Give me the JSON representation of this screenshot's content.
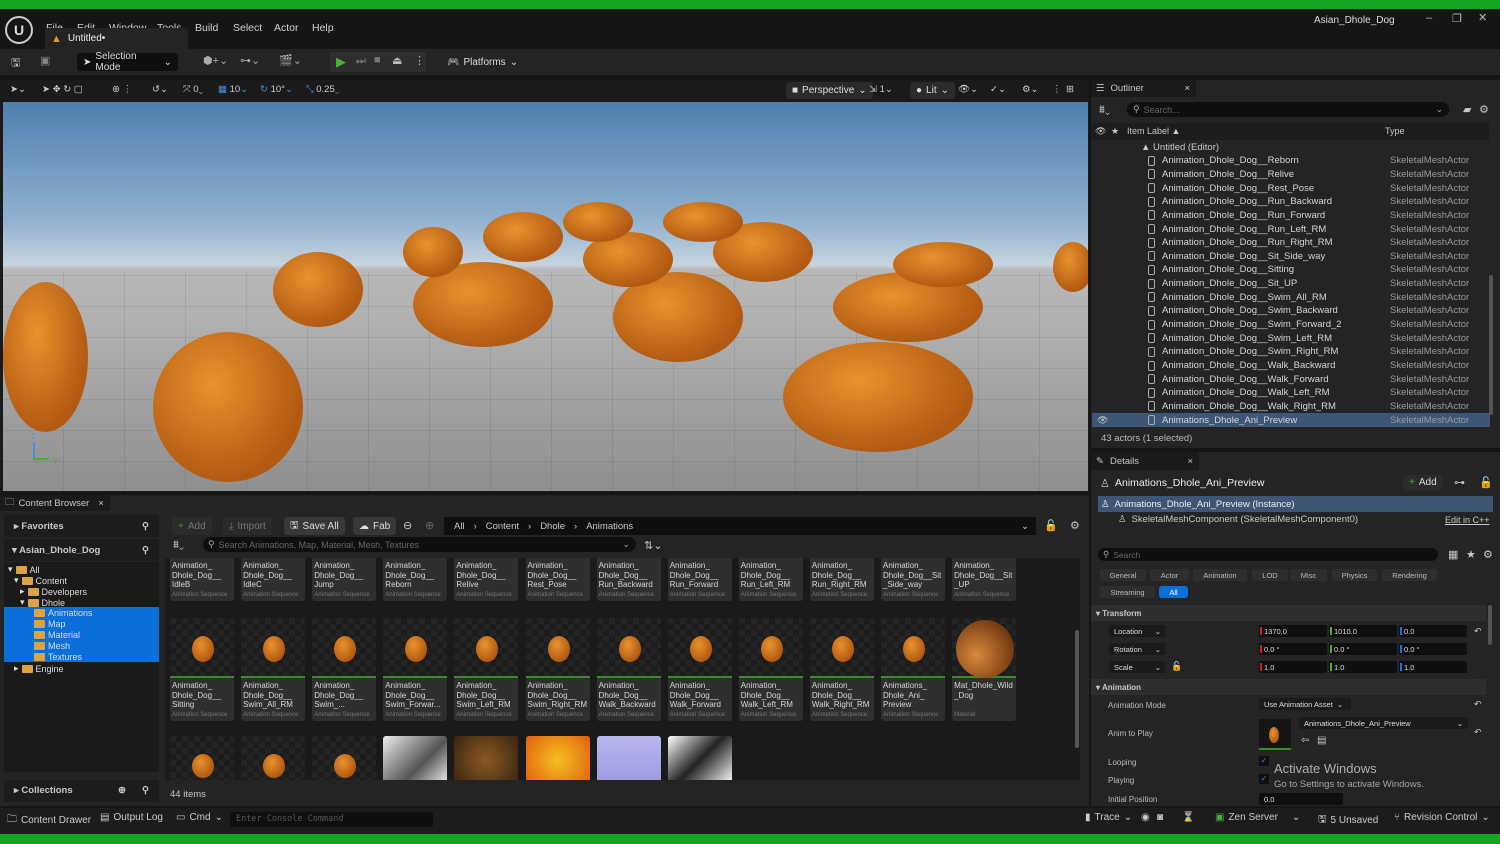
{
  "app": {
    "menu": [
      "File",
      "Edit",
      "Window",
      "Tools",
      "Build",
      "Select",
      "Actor",
      "Help"
    ],
    "doc_tab": "Untitled•",
    "project": "Asian_Dhole_Dog",
    "window_controls": [
      "minimize-icon",
      "restore-icon",
      "close-icon"
    ]
  },
  "toolbar": {
    "selection_mode": "Selection Mode",
    "platforms": "Platforms"
  },
  "viewport_toolbar": {
    "snap_translate": "0",
    "grid": "10",
    "rot_snap": "10°",
    "scale_snap": "0.25",
    "perspective": "Perspective",
    "cam_speed": "1",
    "lit": "Lit",
    "axis_z": "Z",
    "axis_y": "Y"
  },
  "outliner": {
    "tab": "Outliner",
    "search_placeholder": "Search...",
    "col_label": "Item Label ▲",
    "col_type": "Type",
    "root": "Untitled (Editor)",
    "items": [
      {
        "label": "Animation_Dhole_Dog__Reborn",
        "type": "SkeletalMeshActor"
      },
      {
        "label": "Animation_Dhole_Dog__Relive",
        "type": "SkeletalMeshActor"
      },
      {
        "label": "Animation_Dhole_Dog__Rest_Pose",
        "type": "SkeletalMeshActor"
      },
      {
        "label": "Animation_Dhole_Dog__Run_Backward",
        "type": "SkeletalMeshActor"
      },
      {
        "label": "Animation_Dhole_Dog__Run_Forward",
        "type": "SkeletalMeshActor"
      },
      {
        "label": "Animation_Dhole_Dog__Run_Left_RM",
        "type": "SkeletalMeshActor"
      },
      {
        "label": "Animation_Dhole_Dog__Run_Right_RM",
        "type": "SkeletalMeshActor"
      },
      {
        "label": "Animation_Dhole_Dog__Sit_Side_way",
        "type": "SkeletalMeshActor"
      },
      {
        "label": "Animation_Dhole_Dog__Sitting",
        "type": "SkeletalMeshActor"
      },
      {
        "label": "Animation_Dhole_Dog__Sit_UP",
        "type": "SkeletalMeshActor"
      },
      {
        "label": "Animation_Dhole_Dog__Swim_All_RM",
        "type": "SkeletalMeshActor"
      },
      {
        "label": "Animation_Dhole_Dog__Swim_Backward",
        "type": "SkeletalMeshActor"
      },
      {
        "label": "Animation_Dhole_Dog__Swim_Forward_2",
        "type": "SkeletalMeshActor"
      },
      {
        "label": "Animation_Dhole_Dog__Swim_Left_RM",
        "type": "SkeletalMeshActor"
      },
      {
        "label": "Animation_Dhole_Dog__Swim_Right_RM",
        "type": "SkeletalMeshActor"
      },
      {
        "label": "Animation_Dhole_Dog__Walk_Backward",
        "type": "SkeletalMeshActor"
      },
      {
        "label": "Animation_Dhole_Dog__Walk_Forward",
        "type": "SkeletalMeshActor"
      },
      {
        "label": "Animation_Dhole_Dog__Walk_Left_RM",
        "type": "SkeletalMeshActor"
      },
      {
        "label": "Animation_Dhole_Dog__Walk_Right_RM",
        "type": "SkeletalMeshActor"
      },
      {
        "label": "Animations_Dhole_Ani_Preview",
        "type": "SkeletalMeshActor",
        "selected": true
      }
    ],
    "status": "43 actors (1 selected)"
  },
  "details": {
    "tab": "Details",
    "actor": "Animations_Dhole_Ani_Preview",
    "add": "Add",
    "instance": "Animations_Dhole_Ani_Preview (Instance)",
    "component": "SkeletalMeshComponent (SkeletalMeshComponent0)",
    "edit_cpp": "Edit in C++",
    "search_placeholder": "Search",
    "filters": [
      "General",
      "Actor",
      "Animation",
      "LOD",
      "Misc",
      "Physics",
      "Rendering",
      "Streaming",
      "All"
    ],
    "transform": {
      "section": "Transform",
      "location_label": "Location",
      "location": [
        "1370.0",
        "1010.0",
        "0.0"
      ],
      "rotation_label": "Rotation",
      "rotation": [
        "0.0 °",
        "0.0 °",
        "0.0 °"
      ],
      "scale_label": "Scale",
      "scale": [
        "1.0",
        "1.0",
        "1.0"
      ]
    },
    "animation": {
      "section": "Animation",
      "mode_label": "Animation Mode",
      "mode": "Use Animation Asset",
      "anim_label": "Anim to Play",
      "anim": "Animations_Dhole_Ani_Preview",
      "looping_label": "Looping",
      "looping": true,
      "playing_label": "Playing",
      "playing": true,
      "initpos_label": "Initial Position",
      "initpos": "0.0"
    },
    "watermark_title": "Activate Windows",
    "watermark_sub": "Go to Settings to activate Windows."
  },
  "content_browser": {
    "tab": "Content Browser",
    "favorites": "Favorites",
    "project": "Asian_Dhole_Dog",
    "collections": "Collections",
    "add": "Add",
    "import": "Import",
    "save_all": "Save All",
    "fab": "Fab",
    "breadcrumb": [
      "All",
      "Content",
      "Dhole",
      "Animations"
    ],
    "search_placeholder": "Search Animations, Map, Material, Mesh, Textures",
    "count": "44 items",
    "tree": [
      "All",
      "Content",
      "Developers",
      "Dhole",
      "Animations",
      "Map",
      "Material",
      "Mesh",
      "Textures",
      "Engine"
    ],
    "row1": [
      {
        "name": "Animation_\nDhole_Dog__\nIdleB",
        "type": "Animation Sequence"
      },
      {
        "name": "Animation_\nDhole_Dog__\nIdleC",
        "type": "Animation Sequence"
      },
      {
        "name": "Animation_\nDhole_Dog__\nJump",
        "type": "Animation Sequence"
      },
      {
        "name": "Animation_\nDhole_Dog__\nReborn",
        "type": "Animation Sequence"
      },
      {
        "name": "Animation_\nDhole_Dog__\nRelive",
        "type": "Animation Sequence"
      },
      {
        "name": "Animation_\nDhole_Dog__\nRest_Pose",
        "type": "Animation Sequence"
      },
      {
        "name": "Animation_\nDhole_Dog__\nRun_Backward",
        "type": "Animation Sequence"
      },
      {
        "name": "Animation_\nDhole_Dog__\nRun_Forward",
        "type": "Animation Sequence"
      },
      {
        "name": "Animation_\nDhole_Dog__\nRun_Left_RM",
        "type": "Animation Sequence"
      },
      {
        "name": "Animation_\nDhole_Dog__\nRun_Right_RM",
        "type": "Animation Sequence"
      },
      {
        "name": "Animation_\nDhole_Dog__Sit\n_Side_way",
        "type": "Animation Sequence"
      },
      {
        "name": "Animation_\nDhole_Dog__Sit\n_UP",
        "type": "Animation Sequence"
      }
    ],
    "row2": [
      {
        "name": "Animation_\nDhole_Dog__\nSitting",
        "type": "Animation Sequence"
      },
      {
        "name": "Animation_\nDhole_Dog__\nSwim_All_RM",
        "type": "Animation Sequence"
      },
      {
        "name": "Animation_\nDhole_Dog__\nSwim_...",
        "type": "Animation Sequence"
      },
      {
        "name": "Animation_\nDhole_Dog__\nSwim_Forwar...",
        "type": "Animation Sequence"
      },
      {
        "name": "Animation_\nDhole_Dog__\nSwim_Left_RM",
        "type": "Animation Sequence"
      },
      {
        "name": "Animation_\nDhole_Dog__\nSwim_Right_RM",
        "type": "Animation Sequence"
      },
      {
        "name": "Animation_\nDhole_Dog__\nWalk_Backward",
        "type": "Animation Sequence"
      },
      {
        "name": "Animation_\nDhole_Dog__\nWalk_Forward",
        "type": "Animation Sequence"
      },
      {
        "name": "Animation_\nDhole_Dog__\nWalk_Left_RM",
        "type": "Animation Sequence"
      },
      {
        "name": "Animation_\nDhole_Dog__\nWalk_Right_RM",
        "type": "Animation Sequence"
      },
      {
        "name": "Animations_\nDhole_Ani_\nPreview",
        "type": "Animation Sequence"
      },
      {
        "name": "Mat_Dhole_Wild\n_Dog",
        "type": "Material"
      }
    ]
  },
  "statusbar": {
    "content_drawer": "Content Drawer",
    "output_log": "Output Log",
    "cmd": "Cmd",
    "console_placeholder": "Enter Console Command",
    "trace": "Trace",
    "zen": "Zen Server",
    "unsaved": "5 Unsaved",
    "revision": "Revision Control"
  },
  "colors": {
    "accent": "#0070e0",
    "selection": "#3d5675",
    "play": "#4caf3a",
    "frame_green": "#16a51f"
  }
}
